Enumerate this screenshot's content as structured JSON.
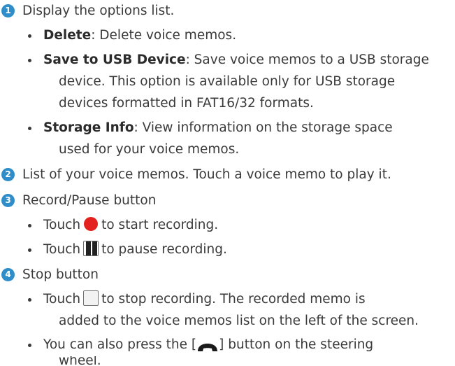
{
  "items": {
    "n1": "1",
    "n2": "2",
    "n3": "3",
    "n4": "4",
    "i1": "Display the options list.",
    "b1_label": "Delete",
    "b1_text": ": Delete voice memos.",
    "b2_label": "Save to USB Device",
    "b2_text_1": ": Save voice memos to a USB storage",
    "b2_text_2": "device. This option is available only for USB storage",
    "b2_text_3": "devices formatted in FAT16/32 formats.",
    "b3_label": "Storage Info",
    "b3_text_1": ": View information on the storage space",
    "b3_text_2": "used for your voice memos.",
    "i2": "List of your voice memos. Touch a voice memo to play it.",
    "i3": "Record/Pause button",
    "touch": "Touch",
    "rec_after": "to start recording.",
    "pause_after": "to pause recording.",
    "i4": "Stop button",
    "stop_after": "to stop recording. The recorded memo is",
    "stop_text_2": "added to the voice memos list on the left of the screen.",
    "press_before": "You can also press the [",
    "press_after": "] button on the steering",
    "press_text_2": "wheel."
  },
  "icons": {
    "record": "record-icon",
    "pause": "pause-icon",
    "stop": "stop-icon",
    "phone": "end-call-icon"
  },
  "colors": {
    "number_badge": "#2f8ec9",
    "record": "#e3221f"
  }
}
